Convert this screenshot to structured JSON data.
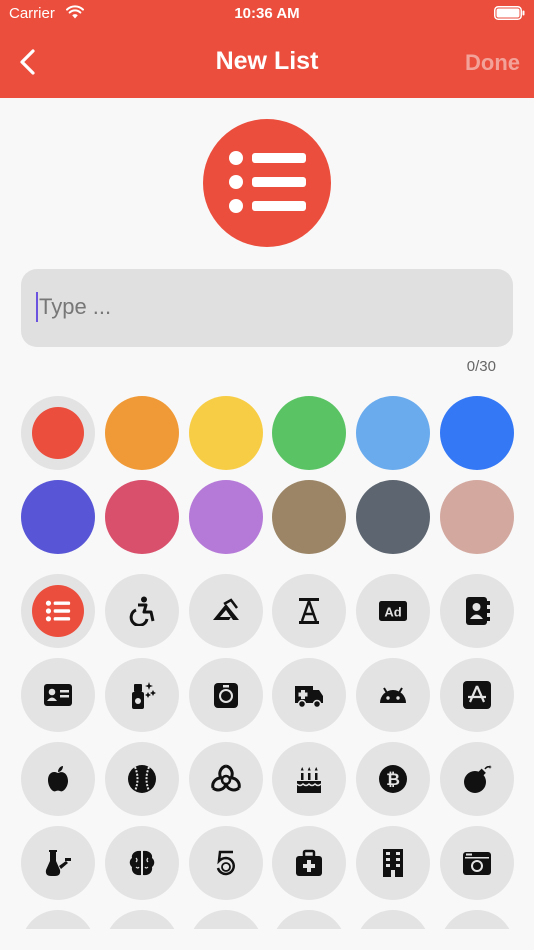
{
  "status_bar": {
    "carrier": "Carrier",
    "time": "10:36 AM"
  },
  "nav": {
    "title": "New List",
    "done_label": "Done",
    "back_icon": "chevron-left-icon"
  },
  "accent": "#eb4e3d",
  "preview": {
    "icon": "list-icon"
  },
  "name_field": {
    "value": "",
    "placeholder": "Type ...",
    "counter": "0/30"
  },
  "colors": [
    {
      "name": "red",
      "hex": "#eb4e3d",
      "selected": true
    },
    {
      "name": "orange",
      "hex": "#f09a37"
    },
    {
      "name": "yellow",
      "hex": "#f8cd46"
    },
    {
      "name": "green",
      "hex": "#5ac465"
    },
    {
      "name": "light-blue",
      "hex": "#6aabee"
    },
    {
      "name": "blue",
      "hex": "#3478f6"
    },
    {
      "name": "indigo",
      "hex": "#5856d6"
    },
    {
      "name": "pink",
      "hex": "#d9506c"
    },
    {
      "name": "purple",
      "hex": "#b57ad8"
    },
    {
      "name": "brown",
      "hex": "#9b8566"
    },
    {
      "name": "gray",
      "hex": "#5d6570"
    },
    {
      "name": "rose",
      "hex": "#d3a89f"
    }
  ],
  "icons": [
    {
      "name": "list-icon",
      "selected": true
    },
    {
      "name": "wheelchair-icon"
    },
    {
      "name": "affiliate-logo-icon"
    },
    {
      "name": "text-height-icon"
    },
    {
      "name": "ad-icon"
    },
    {
      "name": "address-book-icon"
    },
    {
      "name": "address-card-icon"
    },
    {
      "name": "spray-bottle-icon"
    },
    {
      "name": "stopwatch-icon"
    },
    {
      "name": "ambulance-icon"
    },
    {
      "name": "android-icon"
    },
    {
      "name": "app-store-icon"
    },
    {
      "name": "apple-icon"
    },
    {
      "name": "baseball-icon"
    },
    {
      "name": "biohazard-icon"
    },
    {
      "name": "birthday-cake-icon"
    },
    {
      "name": "bitcoin-icon"
    },
    {
      "name": "bomb-icon"
    },
    {
      "name": "bong-icon"
    },
    {
      "name": "brain-icon"
    },
    {
      "name": "500px-icon"
    },
    {
      "name": "medkit-icon"
    },
    {
      "name": "building-icon"
    },
    {
      "name": "camera-retro-icon"
    },
    {
      "name": "icon-25"
    },
    {
      "name": "icon-26"
    },
    {
      "name": "icon-27"
    },
    {
      "name": "icon-28"
    },
    {
      "name": "icon-29"
    },
    {
      "name": "icon-30"
    }
  ]
}
